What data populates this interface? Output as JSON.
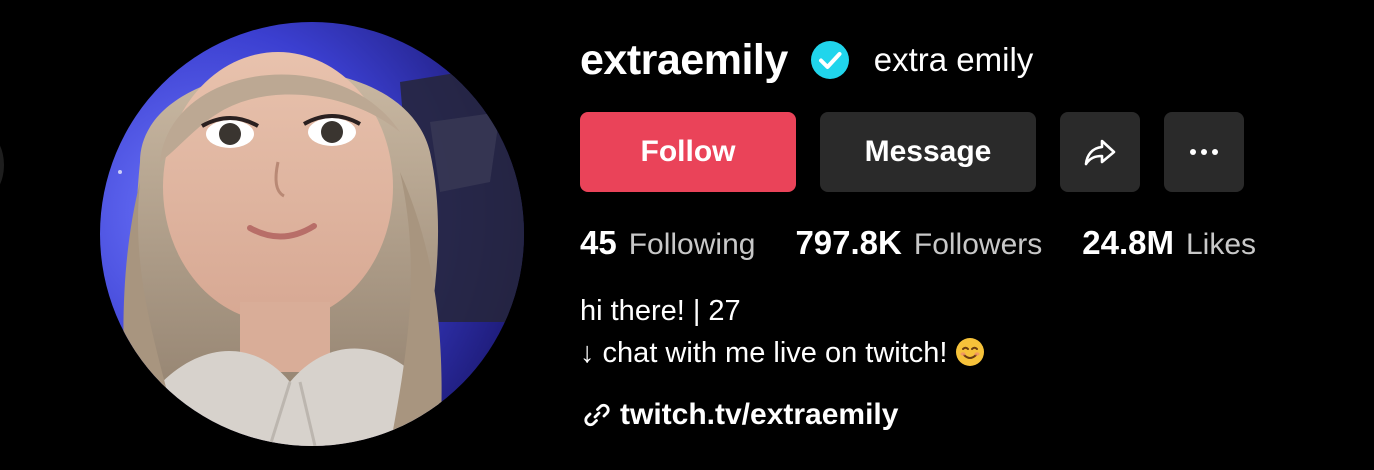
{
  "profile": {
    "username": "extraemily",
    "display_name": "extra emily",
    "verified": true,
    "avatar_icon": "profile-photo"
  },
  "actions": {
    "follow_label": "Follow",
    "message_label": "Message",
    "share_icon": "share-arrow-icon",
    "more_icon": "more-dots-icon"
  },
  "stats": [
    {
      "value": "45",
      "label": "Following"
    },
    {
      "value": "797.8K",
      "label": "Followers"
    },
    {
      "value": "24.8M",
      "label": "Likes"
    }
  ],
  "bio": {
    "line1": "hi there! | 27",
    "line2": "↓ chat with me live on twitch!",
    "line2_emoji": "smiling-face-emoji"
  },
  "link": {
    "text": "twitch.tv/extraemily",
    "icon": "link-icon"
  },
  "colors": {
    "follow_button": "#ea4359",
    "secondary_button": "#2a2a2a",
    "verified_badge": "#20d5ec",
    "background": "#000000"
  }
}
